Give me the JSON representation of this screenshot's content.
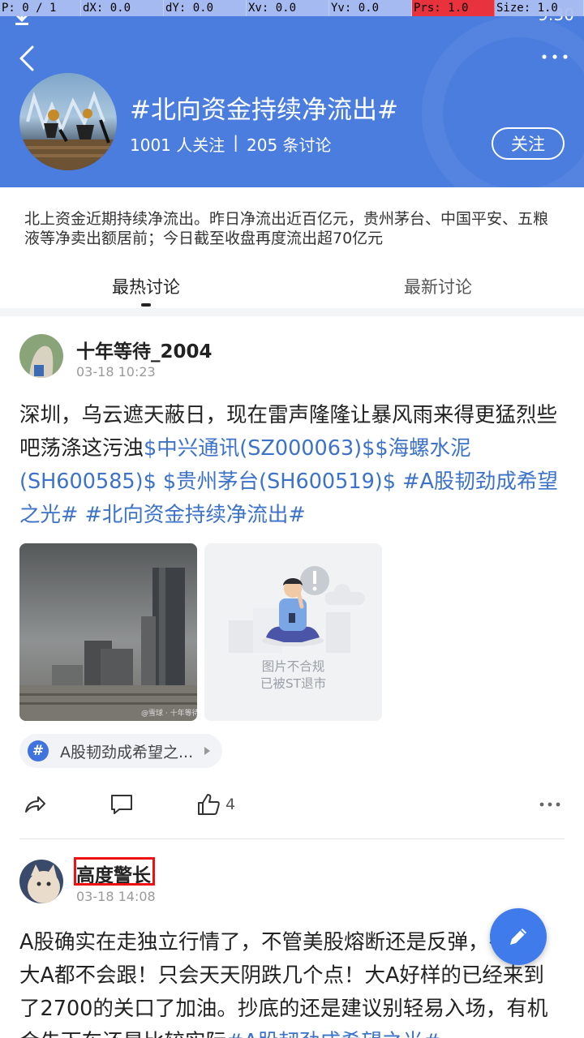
{
  "debug": {
    "pointer": "P: 0 / 1",
    "dx": "dX: 0.0",
    "dy": "dY: 0.0",
    "xv": "Xv: 0.0",
    "yv": "Yv: 0.0",
    "prs": "Prs: 1.0",
    "size": "Size: 1.0"
  },
  "status_bar": {
    "time": "9:30"
  },
  "topic": {
    "title": "#北向资金持续净流出#",
    "followers": "1001 人关注",
    "divider": "|",
    "discussions": "205 条讨论",
    "follow_label": "关注",
    "description": "北上资金近期持续净流出。昨日净流出近百亿元，贵州茅台、中国平安、五粮液等净卖出额居前；今日截至收盘再度流出超70亿元"
  },
  "tabs": [
    {
      "label": "最热讨论",
      "active": true
    },
    {
      "label": "最新讨论",
      "active": false
    }
  ],
  "posts": [
    {
      "author": "十年等待_2004",
      "time": "03-18 10:23",
      "text_plain": "深圳，乌云遮天蔽日，现在雷声隆隆让暴风雨来得更猛烈些吧荡涤这污浊",
      "links": [
        "$中兴通讯(SZ000063)$",
        "$海螺水泥(SH600585)$",
        " $贵州茅台(SH600519)$",
        " #A股韧劲成希望之光#",
        " #北向资金持续净流出#"
      ],
      "image_watermark": "@雪球 · 十年等待",
      "blocked_image": {
        "line1": "图片不合规",
        "line2": "已被ST退市"
      },
      "tag": "A股韧劲成希望之...",
      "likes": "4"
    },
    {
      "author": "高度警长",
      "time": "03-18 14:08",
      "text_plain": "A股确实在走独立行情了，不管美股熔断还是反弹，有跌，大A都不会跟！只会天天阴跌几个点！大A好样的已经来到了2700的关口了加油。抄底的还是建议别轻易入场，有机会先下车还是比较实际",
      "links": [
        "#A股韧劲成希望之光#"
      ]
    }
  ],
  "colors": {
    "header": "#4a7ddd",
    "link": "#3c72c8",
    "fab": "#3f7bea",
    "highlight": "#e11111"
  },
  "icons": [
    "download-icon",
    "back-icon",
    "more-icon",
    "share-icon",
    "comment-icon",
    "like-icon",
    "edit-icon",
    "hashtag-icon"
  ]
}
